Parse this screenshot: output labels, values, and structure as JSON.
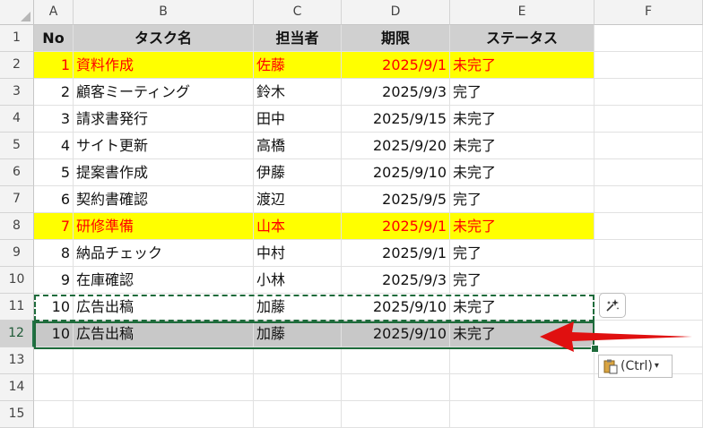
{
  "columns": [
    "A",
    "B",
    "C",
    "D",
    "E",
    "F"
  ],
  "row_numbers": [
    "1",
    "2",
    "3",
    "4",
    "5",
    "6",
    "7",
    "8",
    "9",
    "10",
    "11",
    "12",
    "13",
    "14",
    "15"
  ],
  "header": {
    "no": "No",
    "task": "タスク名",
    "owner": "担当者",
    "due": "期限",
    "status": "ステータス"
  },
  "rows": [
    {
      "no": "1",
      "task": "資料作成",
      "owner": "佐藤",
      "due": "2025/9/1",
      "status": "未完了",
      "highlight": true
    },
    {
      "no": "2",
      "task": "顧客ミーティング",
      "owner": "鈴木",
      "due": "2025/9/3",
      "status": "完了",
      "highlight": false
    },
    {
      "no": "3",
      "task": "請求書発行",
      "owner": "田中",
      "due": "2025/9/15",
      "status": "未完了",
      "highlight": false
    },
    {
      "no": "4",
      "task": "サイト更新",
      "owner": "高橋",
      "due": "2025/9/20",
      "status": "未完了",
      "highlight": false
    },
    {
      "no": "5",
      "task": "提案書作成",
      "owner": "伊藤",
      "due": "2025/9/10",
      "status": "未完了",
      "highlight": false
    },
    {
      "no": "6",
      "task": "契約書確認",
      "owner": "渡辺",
      "due": "2025/9/5",
      "status": "完了",
      "highlight": false
    },
    {
      "no": "7",
      "task": "研修準備",
      "owner": "山本",
      "due": "2025/9/1",
      "status": "未完了",
      "highlight": true
    },
    {
      "no": "8",
      "task": "納品チェック",
      "owner": "中村",
      "due": "2025/9/1",
      "status": "完了",
      "highlight": false
    },
    {
      "no": "9",
      "task": "在庫確認",
      "owner": "小林",
      "due": "2025/9/3",
      "status": "完了",
      "highlight": false
    },
    {
      "no": "10",
      "task": "広告出稿",
      "owner": "加藤",
      "due": "2025/9/10",
      "status": "未完了",
      "highlight": false
    },
    {
      "no": "10",
      "task": "広告出稿",
      "owner": "加藤",
      "due": "2025/9/10",
      "status": "未完了",
      "highlight": false,
      "selected": true
    }
  ],
  "paste_options": {
    "label": "(Ctrl)",
    "icon": "clipboard-icon"
  },
  "quick_analysis": {
    "icon": "sparkle-icon"
  },
  "colors": {
    "highlight_fill": "#ffff00",
    "highlight_text": "#ff0000",
    "selection_border": "#1e6b3b",
    "arrow": "#e01010",
    "header_fill": "#d0d0d0"
  }
}
